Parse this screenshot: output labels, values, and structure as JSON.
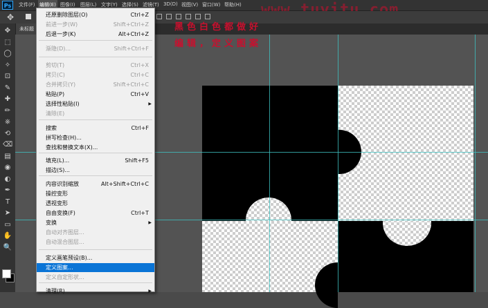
{
  "menubar": {
    "logo": "Ps",
    "items": [
      "文件(F)",
      "编辑(E)",
      "图像(I)",
      "图层(L)",
      "文字(Y)",
      "选择(S)",
      "滤镜(T)",
      "3D(D)",
      "视图(V)",
      "窗口(W)",
      "帮助(H)"
    ],
    "active_index": 1
  },
  "watermark": "www.tuyitu.com",
  "document_tab": "未标题",
  "annotation": {
    "line1": "黑色白色都做好",
    "line2": "编辑，定义图案"
  },
  "edit_menu": [
    {
      "label": "还原删除图层(O)",
      "shortcut": "Ctrl+Z",
      "disabled": false
    },
    {
      "label": "前进一步(W)",
      "shortcut": "Shift+Ctrl+Z",
      "disabled": true
    },
    {
      "label": "后退一步(K)",
      "shortcut": "Alt+Ctrl+Z",
      "disabled": false
    },
    {
      "label": "渐隐(D)...",
      "shortcut": "Shift+Ctrl+F",
      "disabled": true
    },
    {
      "label": "剪切(T)",
      "shortcut": "Ctrl+X",
      "disabled": true
    },
    {
      "label": "拷贝(C)",
      "shortcut": "Ctrl+C",
      "disabled": true
    },
    {
      "label": "合并拷贝(Y)",
      "shortcut": "Shift+Ctrl+C",
      "disabled": true
    },
    {
      "label": "粘贴(P)",
      "shortcut": "Ctrl+V",
      "disabled": false
    },
    {
      "label": "选择性粘贴(I)",
      "shortcut": "",
      "disabled": false,
      "submenu": true
    },
    {
      "label": "清除(E)",
      "shortcut": "",
      "disabled": true
    },
    {
      "label": "搜索",
      "shortcut": "Ctrl+F",
      "disabled": false
    },
    {
      "label": "拼写检查(H)...",
      "shortcut": "",
      "disabled": false
    },
    {
      "label": "查找和替换文本(X)...",
      "shortcut": "",
      "disabled": false
    },
    {
      "label": "填充(L)...",
      "shortcut": "Shift+F5",
      "disabled": false
    },
    {
      "label": "描边(S)...",
      "shortcut": "",
      "disabled": false
    },
    {
      "label": "内容识别缩放",
      "shortcut": "Alt+Shift+Ctrl+C",
      "disabled": false
    },
    {
      "label": "操控变形",
      "shortcut": "",
      "disabled": false
    },
    {
      "label": "透视变形",
      "shortcut": "",
      "disabled": false
    },
    {
      "label": "自由变换(F)",
      "shortcut": "Ctrl+T",
      "disabled": false
    },
    {
      "label": "变换",
      "shortcut": "",
      "disabled": false,
      "submenu": true
    },
    {
      "label": "自动对齐图层...",
      "shortcut": "",
      "disabled": true
    },
    {
      "label": "自动混合图层...",
      "shortcut": "",
      "disabled": true
    },
    {
      "label": "定义画笔预设(B)...",
      "shortcut": "",
      "disabled": false
    },
    {
      "label": "定义图案...",
      "shortcut": "",
      "disabled": false,
      "highlight": true
    },
    {
      "label": "定义自定形状...",
      "shortcut": "",
      "disabled": true
    },
    {
      "label": "清理(R)",
      "shortcut": "",
      "disabled": false,
      "submenu": true
    }
  ],
  "colors": {
    "menu_highlight": "#0a74d6",
    "annotation": "#c8102e",
    "guide": "#3fc1c1"
  },
  "toolbar_icons": [
    "move-icon",
    "marquee-icon",
    "lasso-icon",
    "quick-select-icon",
    "crop-icon",
    "eyedropper-icon",
    "healing-icon",
    "brush-icon",
    "stamp-icon",
    "history-brush-icon",
    "eraser-icon",
    "gradient-icon",
    "blur-icon",
    "dodge-icon",
    "pen-icon",
    "type-icon",
    "path-select-icon",
    "shape-icon",
    "hand-icon",
    "zoom-icon"
  ]
}
